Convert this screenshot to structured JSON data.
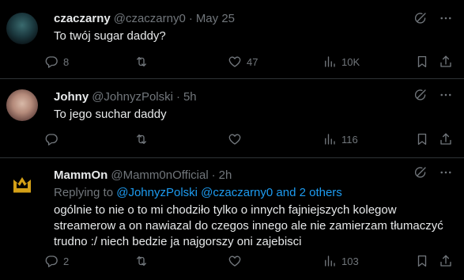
{
  "tweets": [
    {
      "name": "czaczarny",
      "handle": "@czaczarny0",
      "sep": "·",
      "time": "May 25",
      "text": "To twój sugar daddy?",
      "reply_count": "8",
      "retweet_count": "",
      "like_count": "47",
      "view_count": "10K"
    },
    {
      "name": "Johny",
      "handle": "@JohnyzPolski",
      "sep": "·",
      "time": "5h",
      "text": "To jego suchar daddy",
      "reply_count": "",
      "retweet_count": "",
      "like_count": "",
      "view_count": "116"
    },
    {
      "name": "MammOn",
      "handle": "@Mamm0nOfficial",
      "sep": "·",
      "time": "2h",
      "replying_prefix": "Replying to",
      "replying_mentions": "@JohnyzPolski @czaczarny0 and 2 others",
      "text_lines": [
        "ogólnie to nie o to mi chodziło tylko o innych fajniejszych kolegow",
        "streamerow a on nawiazal do czegos innego ale nie zamierzam tłumaczyć",
        "trudno :/ niech bedzie ja najgorszy oni zajebisci"
      ],
      "reply_count": "2",
      "retweet_count": "",
      "like_count": "",
      "view_count": "103",
      "avatar_letter": "M"
    }
  ],
  "icons": {
    "grok": "grok-icon",
    "more": "more-icon",
    "reply": "reply-icon",
    "retweet": "retweet-icon",
    "like": "like-icon",
    "views": "views-icon",
    "bookmark": "bookmark-icon",
    "share": "share-icon"
  },
  "colors": {
    "background": "#000000",
    "text": "#e7e9ea",
    "muted": "#71767b",
    "link": "#1d9bf0",
    "divider": "#2f3336",
    "mammon_gold": "#d4a017"
  }
}
